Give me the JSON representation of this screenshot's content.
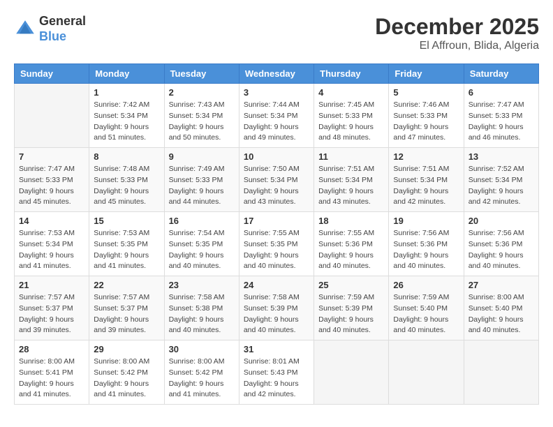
{
  "header": {
    "logo_general": "General",
    "logo_blue": "Blue",
    "month_year": "December 2025",
    "location": "El Affroun, Blida, Algeria"
  },
  "calendar": {
    "days_of_week": [
      "Sunday",
      "Monday",
      "Tuesday",
      "Wednesday",
      "Thursday",
      "Friday",
      "Saturday"
    ],
    "weeks": [
      [
        {
          "day": "",
          "info": ""
        },
        {
          "day": "1",
          "info": "Sunrise: 7:42 AM\nSunset: 5:34 PM\nDaylight: 9 hours\nand 51 minutes."
        },
        {
          "day": "2",
          "info": "Sunrise: 7:43 AM\nSunset: 5:34 PM\nDaylight: 9 hours\nand 50 minutes."
        },
        {
          "day": "3",
          "info": "Sunrise: 7:44 AM\nSunset: 5:34 PM\nDaylight: 9 hours\nand 49 minutes."
        },
        {
          "day": "4",
          "info": "Sunrise: 7:45 AM\nSunset: 5:33 PM\nDaylight: 9 hours\nand 48 minutes."
        },
        {
          "day": "5",
          "info": "Sunrise: 7:46 AM\nSunset: 5:33 PM\nDaylight: 9 hours\nand 47 minutes."
        },
        {
          "day": "6",
          "info": "Sunrise: 7:47 AM\nSunset: 5:33 PM\nDaylight: 9 hours\nand 46 minutes."
        }
      ],
      [
        {
          "day": "7",
          "info": "Sunrise: 7:47 AM\nSunset: 5:33 PM\nDaylight: 9 hours\nand 45 minutes."
        },
        {
          "day": "8",
          "info": "Sunrise: 7:48 AM\nSunset: 5:33 PM\nDaylight: 9 hours\nand 45 minutes."
        },
        {
          "day": "9",
          "info": "Sunrise: 7:49 AM\nSunset: 5:33 PM\nDaylight: 9 hours\nand 44 minutes."
        },
        {
          "day": "10",
          "info": "Sunrise: 7:50 AM\nSunset: 5:34 PM\nDaylight: 9 hours\nand 43 minutes."
        },
        {
          "day": "11",
          "info": "Sunrise: 7:51 AM\nSunset: 5:34 PM\nDaylight: 9 hours\nand 43 minutes."
        },
        {
          "day": "12",
          "info": "Sunrise: 7:51 AM\nSunset: 5:34 PM\nDaylight: 9 hours\nand 42 minutes."
        },
        {
          "day": "13",
          "info": "Sunrise: 7:52 AM\nSunset: 5:34 PM\nDaylight: 9 hours\nand 42 minutes."
        }
      ],
      [
        {
          "day": "14",
          "info": "Sunrise: 7:53 AM\nSunset: 5:34 PM\nDaylight: 9 hours\nand 41 minutes."
        },
        {
          "day": "15",
          "info": "Sunrise: 7:53 AM\nSunset: 5:35 PM\nDaylight: 9 hours\nand 41 minutes."
        },
        {
          "day": "16",
          "info": "Sunrise: 7:54 AM\nSunset: 5:35 PM\nDaylight: 9 hours\nand 40 minutes."
        },
        {
          "day": "17",
          "info": "Sunrise: 7:55 AM\nSunset: 5:35 PM\nDaylight: 9 hours\nand 40 minutes."
        },
        {
          "day": "18",
          "info": "Sunrise: 7:55 AM\nSunset: 5:36 PM\nDaylight: 9 hours\nand 40 minutes."
        },
        {
          "day": "19",
          "info": "Sunrise: 7:56 AM\nSunset: 5:36 PM\nDaylight: 9 hours\nand 40 minutes."
        },
        {
          "day": "20",
          "info": "Sunrise: 7:56 AM\nSunset: 5:36 PM\nDaylight: 9 hours\nand 40 minutes."
        }
      ],
      [
        {
          "day": "21",
          "info": "Sunrise: 7:57 AM\nSunset: 5:37 PM\nDaylight: 9 hours\nand 39 minutes."
        },
        {
          "day": "22",
          "info": "Sunrise: 7:57 AM\nSunset: 5:37 PM\nDaylight: 9 hours\nand 39 minutes."
        },
        {
          "day": "23",
          "info": "Sunrise: 7:58 AM\nSunset: 5:38 PM\nDaylight: 9 hours\nand 40 minutes."
        },
        {
          "day": "24",
          "info": "Sunrise: 7:58 AM\nSunset: 5:39 PM\nDaylight: 9 hours\nand 40 minutes."
        },
        {
          "day": "25",
          "info": "Sunrise: 7:59 AM\nSunset: 5:39 PM\nDaylight: 9 hours\nand 40 minutes."
        },
        {
          "day": "26",
          "info": "Sunrise: 7:59 AM\nSunset: 5:40 PM\nDaylight: 9 hours\nand 40 minutes."
        },
        {
          "day": "27",
          "info": "Sunrise: 8:00 AM\nSunset: 5:40 PM\nDaylight: 9 hours\nand 40 minutes."
        }
      ],
      [
        {
          "day": "28",
          "info": "Sunrise: 8:00 AM\nSunset: 5:41 PM\nDaylight: 9 hours\nand 41 minutes."
        },
        {
          "day": "29",
          "info": "Sunrise: 8:00 AM\nSunset: 5:42 PM\nDaylight: 9 hours\nand 41 minutes."
        },
        {
          "day": "30",
          "info": "Sunrise: 8:00 AM\nSunset: 5:42 PM\nDaylight: 9 hours\nand 41 minutes."
        },
        {
          "day": "31",
          "info": "Sunrise: 8:01 AM\nSunset: 5:43 PM\nDaylight: 9 hours\nand 42 minutes."
        },
        {
          "day": "",
          "info": ""
        },
        {
          "day": "",
          "info": ""
        },
        {
          "day": "",
          "info": ""
        }
      ]
    ]
  }
}
